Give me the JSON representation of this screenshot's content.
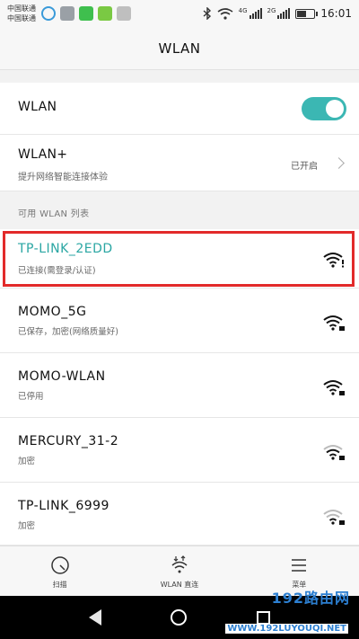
{
  "status_bar": {
    "carrier_1": "中国联通",
    "carrier_2": "中国联通",
    "net_tag_1": "4G",
    "net_tag_2": "2G",
    "battery_level": 0.55,
    "time": "16:01"
  },
  "title": "WLAN",
  "wlan_toggle": {
    "label": "WLAN",
    "on": true
  },
  "wlan_plus": {
    "label": "WLAN+",
    "subtitle": "提升网络智能连接体验",
    "status": "已开启"
  },
  "section_header": "可用 WLAN 列表",
  "networks": [
    {
      "name": "TP-LINK_2EDD",
      "status": "已连接(需登录/认证)",
      "connected": true
    },
    {
      "name": "MOMO_5G",
      "status": "已保存，加密(网络质量好)",
      "connected": false
    },
    {
      "name": "MOMO-WLAN",
      "status": "已停用",
      "connected": false
    },
    {
      "name": "MERCURY_31-2",
      "status": "加密",
      "connected": false
    },
    {
      "name": "TP-LINK_6999",
      "status": "加密",
      "connected": false
    }
  ],
  "toolbar": {
    "scan_label": "扫描",
    "wlan_direct_label": "WLAN 直连",
    "menu_label": "菜单"
  },
  "watermark": {
    "title": "192路由网",
    "url": "WWW.192LUYOUQI.NET"
  },
  "colors": {
    "accent": "#2aa6a3",
    "highlight": "#e22a2a",
    "toggle": "#3bb7b3"
  }
}
